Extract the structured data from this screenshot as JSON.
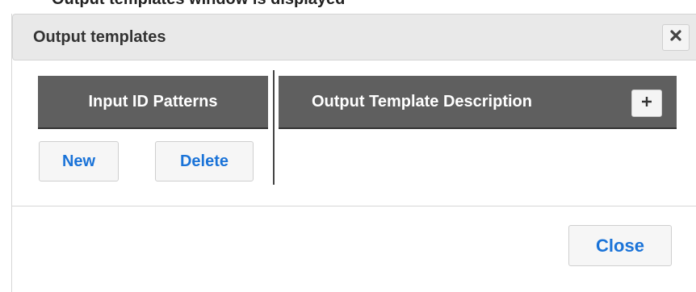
{
  "background_crop": {
    "text": "Output templates window is displayed"
  },
  "dialog": {
    "title": "Output templates",
    "close_x_icon": "close-icon",
    "left_panel": {
      "header": "Input ID Patterns",
      "new_label": "New",
      "delete_label": "Delete"
    },
    "right_panel": {
      "header": "Output Template Description",
      "add_icon": "plus-icon"
    },
    "footer": {
      "close_label": "Close"
    }
  },
  "colors": {
    "header_bg": "#e9e9e9",
    "panel_header_bg": "#5f5f5f",
    "link_blue": "#1a73d8"
  }
}
